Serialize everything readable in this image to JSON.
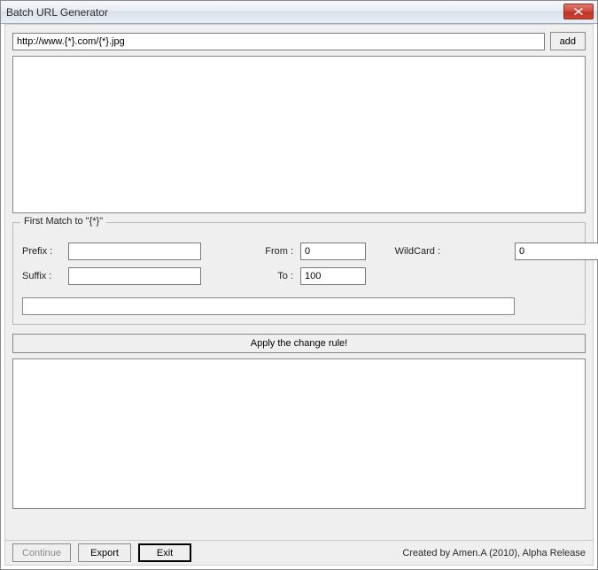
{
  "window": {
    "title": "Batch URL Generator"
  },
  "url_row": {
    "url_value": "http://www.{*}.com/{*}.jpg",
    "add_label": "add"
  },
  "group": {
    "legend": "First Match to \"{*}\"",
    "prefix_label": "Prefix :",
    "suffix_label": "Suffix :",
    "from_label": "From :",
    "to_label": "To :",
    "wildcard_label": "WildCard :",
    "prefix_value": "",
    "suffix_value": "",
    "from_value": "0",
    "to_value": "100",
    "wildcard_value": "0",
    "preview_value": ""
  },
  "apply": {
    "label": "Apply the change rule!"
  },
  "bottom": {
    "continue_label": "Continue",
    "export_label": "Export",
    "exit_label": "Exit",
    "credit": "Created by Amen.A (2010), Alpha Release"
  }
}
